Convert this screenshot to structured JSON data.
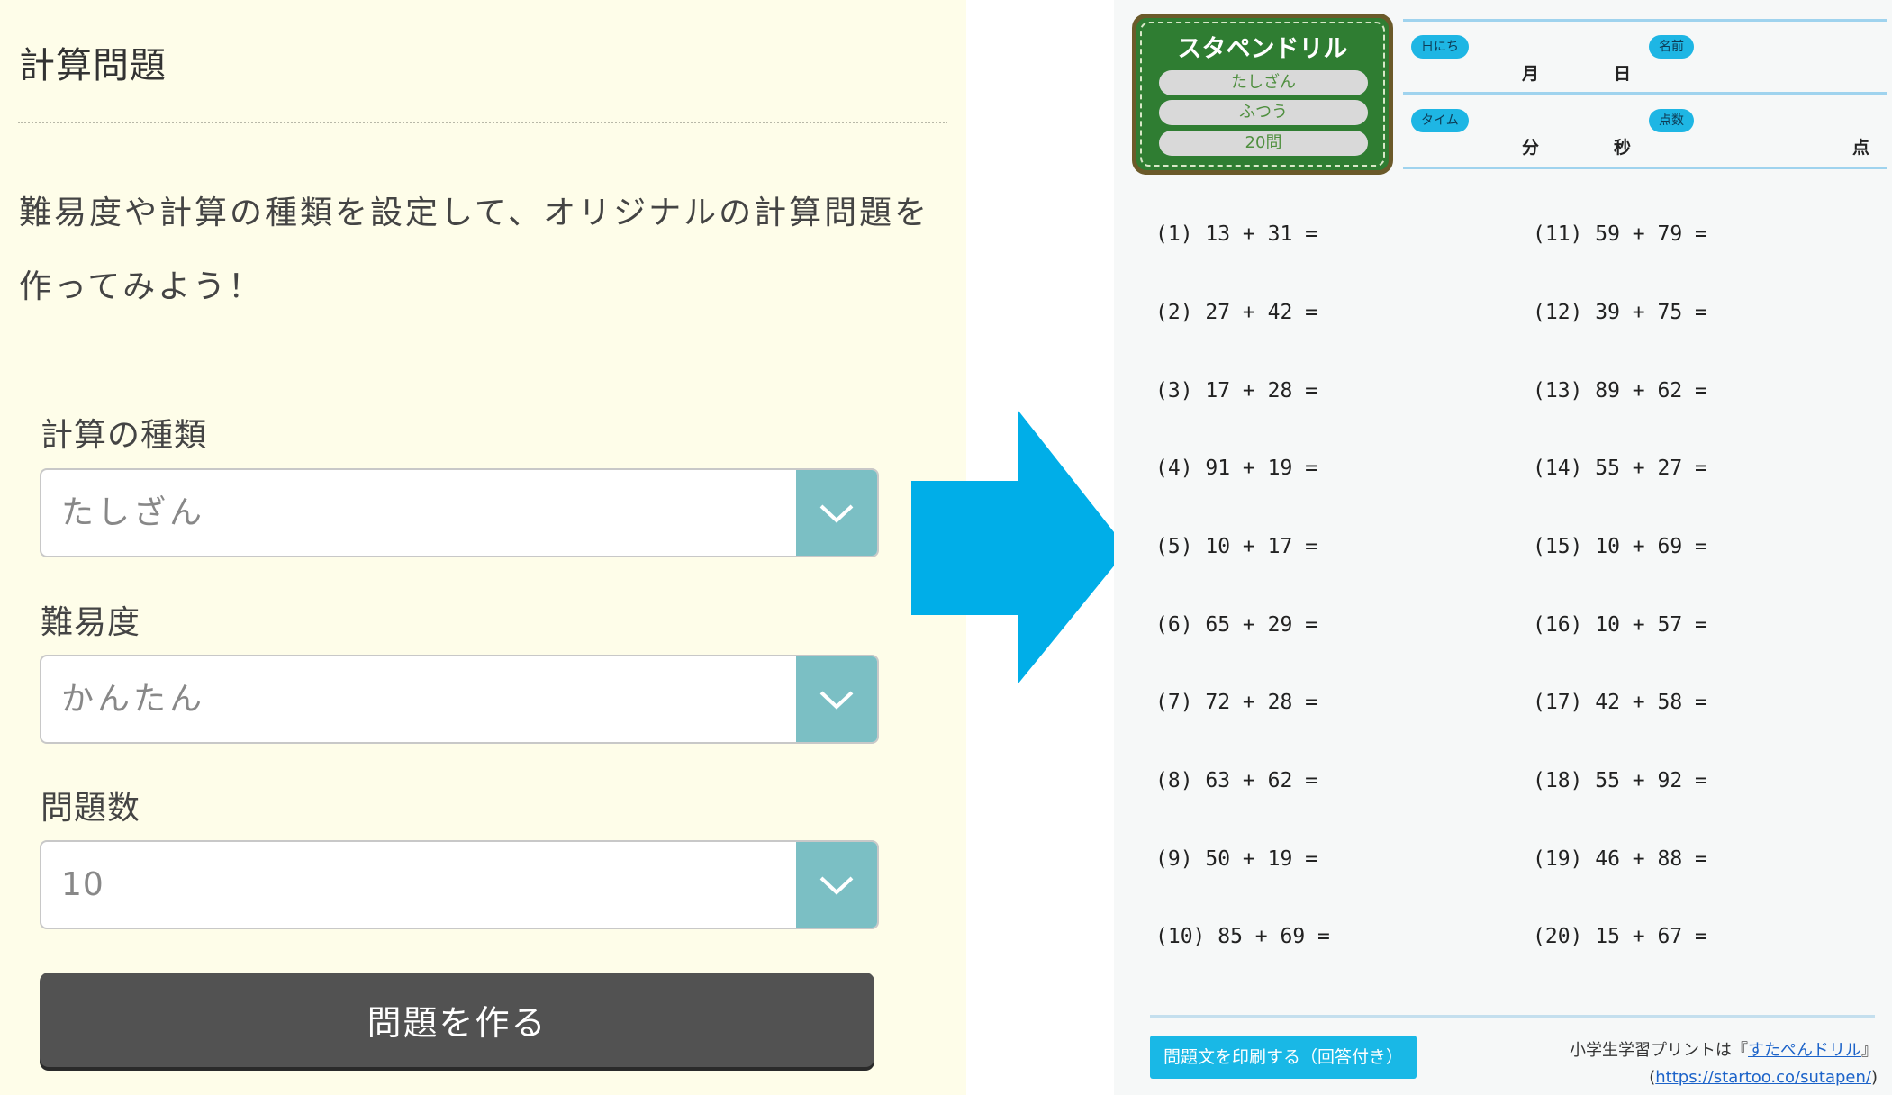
{
  "form": {
    "title": "計算問題",
    "description": "難易度や計算の種類を設定して、オリジナルの計算問題を作ってみよう！",
    "fields": [
      {
        "label": "計算の種類",
        "value": "たしざん",
        "icon": "chevron-down-icon"
      },
      {
        "label": "難易度",
        "value": "かんたん",
        "icon": "chevron-down-icon"
      },
      {
        "label": "問題数",
        "value": "10",
        "icon": "chevron-down-icon"
      }
    ],
    "submit_label": "問題を作る"
  },
  "arrow": {
    "icon": "right-arrow-icon",
    "color": "#00aee8"
  },
  "worksheet": {
    "badge": {
      "title": "スタペンドリル",
      "operation": "たしざん",
      "difficulty": "ふつう",
      "count": "20問"
    },
    "header": {
      "date_tag": "日にち",
      "month": "月",
      "day": "日",
      "name_tag": "名前",
      "time_tag": "タイム",
      "minutes": "分",
      "seconds": "秒",
      "score_tag": "点数",
      "points": "点"
    },
    "problems": [
      "(1) 13 + 31 =",
      "(2) 27 + 42 =",
      "(3) 17 + 28 =",
      "(4) 91 + 19 =",
      "(5) 10 + 17 =",
      "(6) 65 + 29 =",
      "(7) 72 + 28 =",
      "(8) 63 + 62 =",
      "(9) 50 + 19 =",
      "(10) 85 + 69 =",
      "(11) 59 + 79 =",
      "(12) 39 + 75 =",
      "(13) 89 + 62 =",
      "(14) 55 + 27 =",
      "(15) 10 + 69 =",
      "(16) 10 + 57 =",
      "(17) 42 + 58 =",
      "(18) 55 + 92 =",
      "(19) 46 + 88 =",
      "(20) 15 + 67 ="
    ],
    "print_label": "問題文を印刷する（回答付き）",
    "credit_prefix": "小学生学習プリントは",
    "credit_open": "『",
    "credit_link": "すたぺんドリル",
    "credit_close": "』",
    "credit_paren_open": "(",
    "credit_url": "https://startoo.co/sutapen/",
    "credit_paren_close": ")"
  },
  "colors": {
    "panel_bg": "#fefde9",
    "select_arrow_bg": "#7bbfc4",
    "submit_bg": "#525252",
    "badge_green": "#2f7d32",
    "tag_blue": "#1eb6e4",
    "print_button": "#19b8e6"
  }
}
